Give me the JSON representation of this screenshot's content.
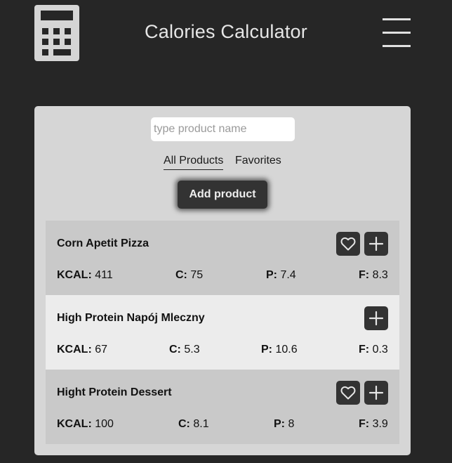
{
  "header": {
    "title": "Calories Calculator",
    "logo_icon": "calculator-icon",
    "menu_icon": "hamburger-menu-icon"
  },
  "search": {
    "placeholder": "type product name",
    "value": ""
  },
  "tabs": [
    {
      "label": "All Products",
      "active": true
    },
    {
      "label": "Favorites",
      "active": false
    }
  ],
  "add_button_label": "Add product",
  "stat_labels": {
    "kcal": "KCAL:",
    "c": "C:",
    "p": "P:",
    "f": "F:"
  },
  "products": [
    {
      "name": "Corn Apetit Pizza",
      "kcal": "411",
      "c": "75",
      "p": "7.4",
      "f": "8.3",
      "has_favorite": true,
      "bg": "#c9c9c9"
    },
    {
      "name": "High Protein Napój Mleczny",
      "kcal": "67",
      "c": "5.3",
      "p": "10.6",
      "f": "0.3",
      "has_favorite": false,
      "bg": "#ececec"
    },
    {
      "name": "Hight Protein Dessert",
      "kcal": "100",
      "c": "8.1",
      "p": "8",
      "f": "3.9",
      "has_favorite": true,
      "bg": "#c9c9c9"
    }
  ],
  "colors": {
    "background": "#262626",
    "panel": "#d6d6d6",
    "button": "#333333"
  }
}
